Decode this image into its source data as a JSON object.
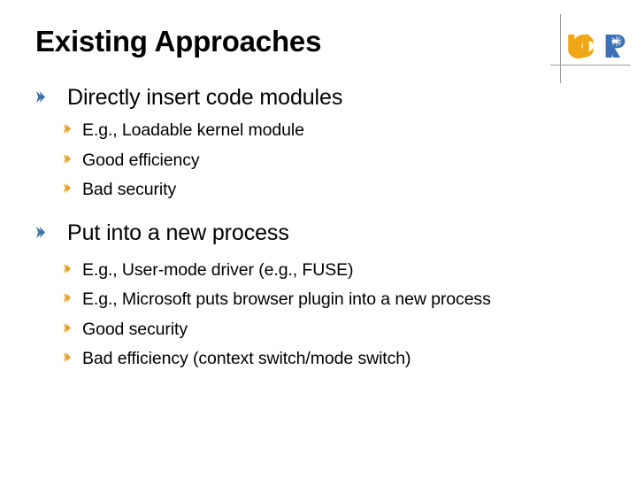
{
  "slide": {
    "title": "Existing Approaches",
    "background_color": "#ffffff",
    "text_color": "#000000"
  },
  "logo": {
    "name": "UCR",
    "text_uc": "UC",
    "text_r": "R",
    "uc_color": "#efa719",
    "r_color": "#3b6fb6",
    "rule_color": "#9a9a9a"
  },
  "bullets": {
    "level1_marker_color": "#3d6ea8",
    "level2_marker_color": "#e0a32e",
    "items": [
      {
        "label": "Directly insert code modules",
        "children": [
          {
            "label": "E.g., Loadable kernel module"
          },
          {
            "label": "Good efficiency"
          },
          {
            "label": "Bad security"
          }
        ]
      },
      {
        "label": "Put into a new process",
        "children": [
          {
            "label": "E.g., User-mode driver (e.g., FUSE)"
          },
          {
            "label": "E.g., Microsoft puts browser plugin into a new process"
          },
          {
            "label": "Good security"
          },
          {
            "label": "Bad efficiency (context switch/mode switch)"
          }
        ]
      }
    ]
  }
}
